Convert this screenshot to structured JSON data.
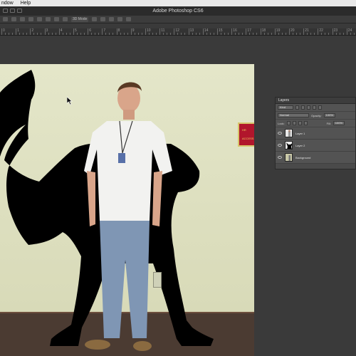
{
  "menubar": {
    "items": [
      "ndow",
      "Help"
    ]
  },
  "app": {
    "title": "Adobe Photoshop CS6"
  },
  "options": {
    "mode_label": "3D Mode"
  },
  "ruler": {
    "labels": [
      "0",
      "1",
      "2",
      "3",
      "4",
      "5",
      "6",
      "7",
      "8",
      "9",
      "10",
      "11",
      "12",
      "13",
      "14",
      "15",
      "16",
      "17",
      "18",
      "19",
      "20",
      "21",
      "22",
      "23",
      "24"
    ]
  },
  "sign": {
    "line1": "HR",
    "line2": "ACCESS"
  },
  "layers_panel": {
    "tab": "Layers",
    "kind_label": "Kind",
    "blend_mode": "Normal",
    "opacity_label": "Opacity:",
    "opacity_value": "100%",
    "lock_label": "Lock:",
    "fill_label": "Fill:",
    "fill_value": "100%",
    "layers": [
      {
        "name": "Layer 1"
      },
      {
        "name": "Layer 2"
      },
      {
        "name": "Background"
      }
    ]
  },
  "colors": {
    "canvas_wall": "#e4e6c9",
    "silhouette": "#000000",
    "panel_bg": "#535353",
    "sign_red": "#b1162c"
  }
}
